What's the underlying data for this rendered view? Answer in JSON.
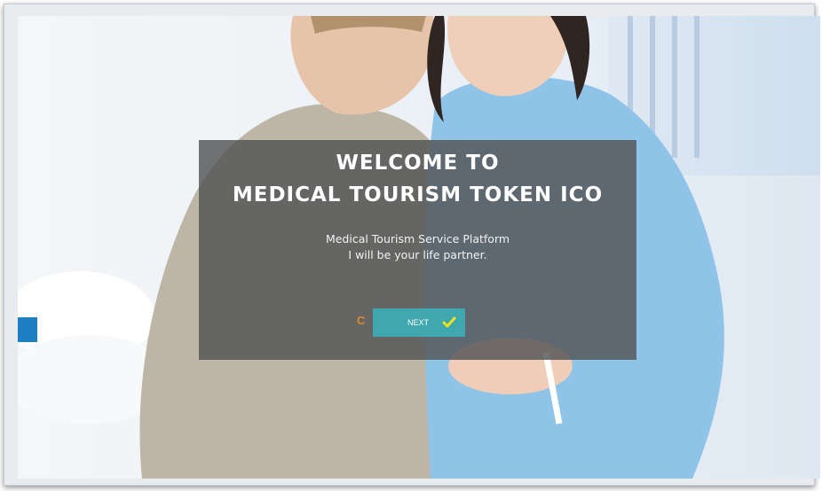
{
  "hero": {
    "title_line1": "WELCOME TO",
    "title_line2": "MEDICAL TOURISM TOKEN ICO",
    "subtitle_line1": "Medical Tourism Service Platform",
    "subtitle_line2": "I will be your life partner.",
    "stray_char": "C",
    "next_label": "NEXT",
    "next_icon": "check-icon"
  },
  "colors": {
    "overlay": "#525456",
    "button": "#3fa7ae",
    "check": "#f2e21a",
    "accent": "#e08a2c"
  }
}
